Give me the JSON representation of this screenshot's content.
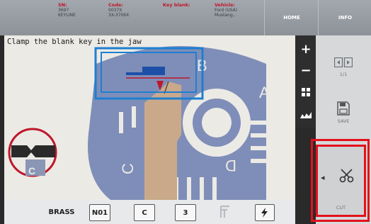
{
  "header": {
    "sn": {
      "title": "SN:",
      "line1": "3697",
      "line2": "KEYLINE"
    },
    "code": {
      "title": "Code:",
      "line1": "0037X",
      "line2": "3X-3706X"
    },
    "key_blank": {
      "title": "Key blank:"
    },
    "vehicle": {
      "title": "Vehicle:",
      "line1": "Ford (USA)",
      "line2": "Mustang..."
    },
    "home_label": "HOME",
    "info_label": "INFO"
  },
  "work": {
    "instruction": "Clamp the blank key in the jaw",
    "wheel_letters": [
      "A",
      "B",
      "C",
      "D"
    ],
    "jaw_letter": "C"
  },
  "side_tools": {
    "plus_icon": "plus-icon",
    "minus_icon": "minus-icon",
    "grid_icon": "grid-icon",
    "cut_profile_icon": "cut-profile-icon"
  },
  "right_panel": {
    "page_counter": "1/1",
    "save_label": "SAVE",
    "cut_label": "CUT"
  },
  "bottom": {
    "material": "BRASS",
    "side_code": "N01",
    "side_letter": "C",
    "depth_number": "3"
  },
  "colors": {
    "accent": "#c0162a",
    "highlight_box": "#1e7fd0",
    "wheel": "#7f8eb8"
  }
}
